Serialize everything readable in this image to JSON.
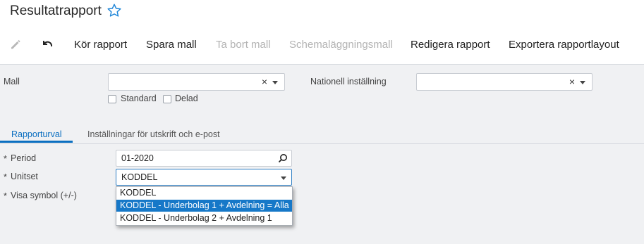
{
  "page": {
    "title": "Resultatrapport"
  },
  "toolbar": {
    "run_report": "Kör rapport",
    "save_template": "Spara mall",
    "delete_template": "Ta bort mall",
    "schedule_template": "Schemaläggningsmall",
    "edit_report": "Redigera rapport",
    "export_layout": "Exportera rapportlayout"
  },
  "template": {
    "mall_label": "Mall",
    "mall_value": "",
    "standard_label": "Standard",
    "shared_label": "Delad",
    "national_label": "Nationell inställning",
    "national_value": ""
  },
  "tabs": {
    "report_selection": "Rapporturval",
    "print_email": "Inställningar för utskrift och e-post"
  },
  "fields": {
    "period_label": "Period",
    "period_value": "01-2020",
    "unitset_label": "Unitset",
    "unitset_value": "KODDEL",
    "show_symbol_label": "Visa symbol (+/-)",
    "required_mark": "*"
  },
  "unitset_options": [
    {
      "label": "KODDEL",
      "selected": false
    },
    {
      "label": "KODDEL - Underbolag 1 + Avdelning = Alla",
      "selected": true
    },
    {
      "label": "KODDEL - Underbolag 2 + Avdelning 1",
      "selected": false
    }
  ],
  "colors": {
    "accent": "#0b6fc0",
    "selected_option": "#1678c8",
    "star": "#1f86d8"
  }
}
